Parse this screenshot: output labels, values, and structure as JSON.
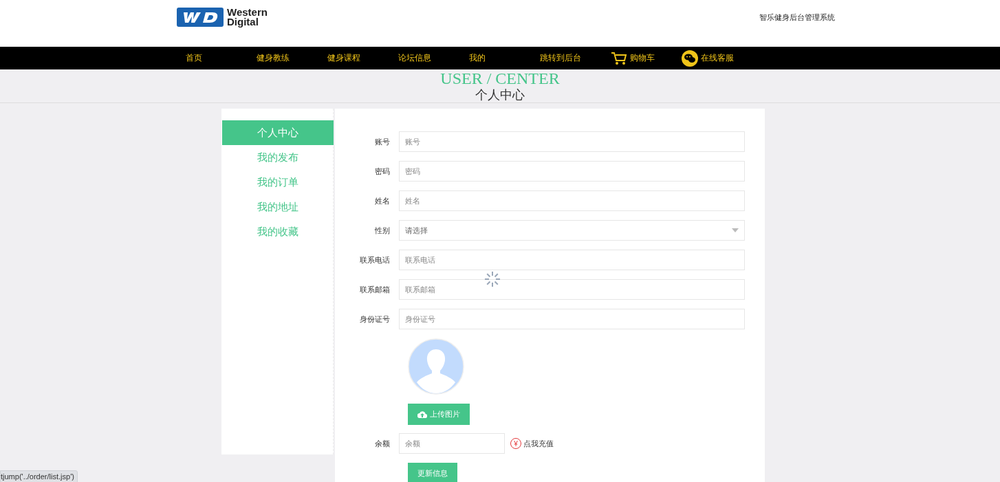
{
  "header": {
    "logo_line1": "Western",
    "logo_line2": "Digital",
    "system_name": "智乐健身后台管理系统"
  },
  "nav": [
    {
      "label": "首页",
      "kind": "text"
    },
    {
      "label": "健身教练",
      "kind": "text"
    },
    {
      "label": "健身课程",
      "kind": "text"
    },
    {
      "label": "论坛信息",
      "kind": "text"
    },
    {
      "label": "我的",
      "kind": "text"
    },
    {
      "label": "跳转到后台",
      "kind": "text"
    },
    {
      "label": "购物车",
      "kind": "cart"
    },
    {
      "label": "在线客服",
      "kind": "chat"
    }
  ],
  "page_title": {
    "english": "USER / CENTER",
    "title": "个人中心"
  },
  "sidebar": {
    "items": [
      {
        "label": "个人中心",
        "selected": true
      },
      {
        "label": "我的发布",
        "selected": false
      },
      {
        "label": "我的订单",
        "selected": false
      },
      {
        "label": "我的地址",
        "selected": false
      },
      {
        "label": "我的收藏",
        "selected": false
      }
    ]
  },
  "form": {
    "fields": [
      {
        "label": "账号",
        "kind": "text",
        "placeholder": "账号"
      },
      {
        "label": "密码",
        "kind": "text",
        "placeholder": "密码"
      },
      {
        "label": "姓名",
        "kind": "text",
        "placeholder": "姓名"
      },
      {
        "label": "性别",
        "kind": "select",
        "placeholder": "请选择"
      },
      {
        "label": "联系电话",
        "kind": "text",
        "placeholder": "联系电话"
      },
      {
        "label": "联系邮箱",
        "kind": "text",
        "placeholder": "联系邮箱"
      },
      {
        "label": "身份证号",
        "kind": "text",
        "placeholder": "身份证号"
      }
    ],
    "upload_button": "上传图片",
    "balance": {
      "label": "余额",
      "placeholder": "余额",
      "recharge_icon": "¥",
      "recharge_link": "点我充值"
    },
    "submit_button": "更新信息"
  },
  "status_tooltip": "tjump('../order/list.jsp')"
}
